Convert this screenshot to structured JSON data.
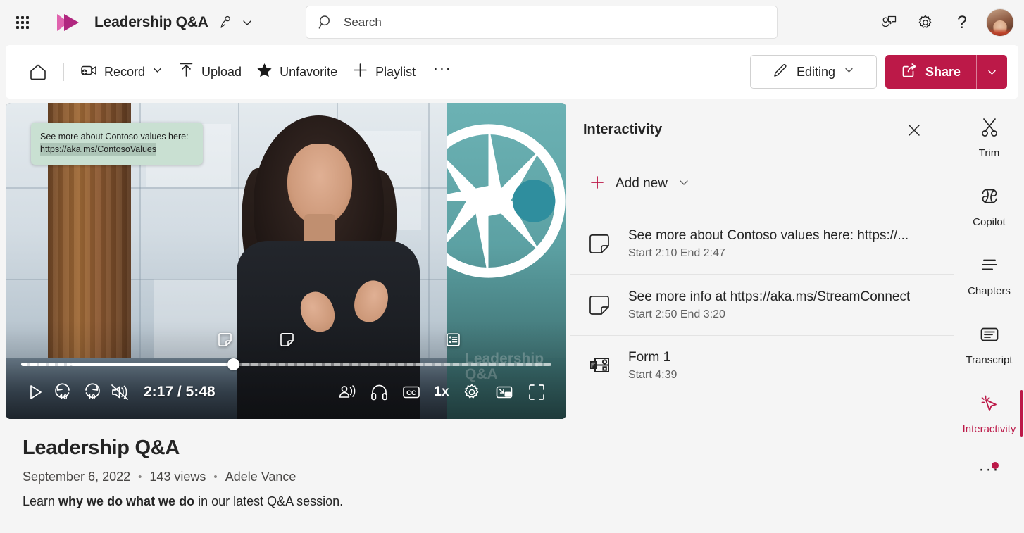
{
  "theme": {
    "accent": "#bc1948",
    "brand_pink": "#d94c9a",
    "brand_magenta": "#b0267f"
  },
  "header": {
    "waffle_icon": "app-launcher-icon",
    "logo_icon": "microsoft-stream-logo",
    "app_title": "Leadership Q&A",
    "title_people_icon": "people-shared-icon",
    "title_chevron_icon": "chevron-down-icon",
    "search": {
      "icon": "search-icon",
      "placeholder": "Search",
      "value": ""
    },
    "feedback_icon": "feedback-icon",
    "settings_icon": "gear-icon",
    "help_icon": "?",
    "help_label": "help-question-icon",
    "avatar_name": "avatar"
  },
  "commandbar": {
    "home_icon": "home-icon",
    "items": [
      {
        "label": "Record",
        "icon": "video-record-icon",
        "has_chevron": true
      },
      {
        "label": "Upload",
        "icon": "upload-arrow-icon",
        "has_chevron": false
      },
      {
        "label": "Unfavorite",
        "icon": "star-filled-icon",
        "has_chevron": false
      },
      {
        "label": "Playlist",
        "icon": "plus-icon",
        "has_chevron": false
      }
    ],
    "overflow_label": "···",
    "editing": {
      "label": "Editing",
      "icon": "pencil-icon",
      "chevron": "chevron-down-icon"
    },
    "share": {
      "label": "Share",
      "icon": "share-icon",
      "chevron": "chevron-down-icon"
    }
  },
  "player": {
    "callout": {
      "line1": "See more about Contoso values here:",
      "link": "https://aka.ms/ContosoValues"
    },
    "watermark": "Leadership\nQ&A",
    "timecode": "2:17 / 5:48",
    "current_time": "2:17",
    "duration": "5:48",
    "progress_percent": 40,
    "speed": "1x",
    "controls": {
      "play_icon": "play-icon",
      "rewind_label": "10",
      "rewind_icon": "rewind-10-icon",
      "forward_label": "10",
      "forward_icon": "forward-10-icon",
      "mute_icon": "volume-muted-icon",
      "noise_icon": "noise-suppression-icon",
      "audio_icon": "headphones-icon",
      "captions_icon": "closed-captions-icon",
      "settings_icon": "gear-icon",
      "pip_icon": "picture-in-picture-icon",
      "fullscreen_icon": "fullscreen-icon"
    },
    "timeline_markers": [
      {
        "icon": "sticky-note-icon",
        "position_percent": 37
      },
      {
        "icon": "sticky-note-icon",
        "position_percent": 49
      },
      {
        "icon": "form-list-icon",
        "position_percent": 79
      }
    ]
  },
  "video_meta": {
    "title": "Leadership Q&A",
    "date": "September 6, 2022",
    "views": "143 views",
    "author": "Adele Vance",
    "separator": "•",
    "description_pre": "Learn ",
    "description_bold": "why we do what we do",
    "description_post": " in our latest Q&A session."
  },
  "interactivity_panel": {
    "title": "Interactivity",
    "close_icon": "close-icon",
    "add_new": {
      "label": "Add new",
      "icon": "plus-icon",
      "chevron": "chevron-down-icon"
    },
    "items": [
      {
        "icon": "sticky-note-icon",
        "title": "See more about Contoso values here: https://...",
        "time": "Start 2:10 End 2:47"
      },
      {
        "icon": "sticky-note-icon",
        "title": "See more info at https://aka.ms/StreamConnect",
        "time": "Start 2:50 End 3:20"
      },
      {
        "icon": "form-icon",
        "title": "Form 1",
        "time": "Start 4:39"
      }
    ]
  },
  "rail": {
    "items": [
      {
        "label": "Trim",
        "icon": "scissors-icon",
        "active": false
      },
      {
        "label": "Copilot",
        "icon": "copilot-icon",
        "active": false
      },
      {
        "label": "Chapters",
        "icon": "chapters-lines-icon",
        "active": false
      },
      {
        "label": "Transcript",
        "icon": "transcript-icon",
        "active": false
      },
      {
        "label": "Interactivity",
        "icon": "interactivity-cursor-icon",
        "active": true
      }
    ],
    "overflow_label": "···",
    "overflow_badge": true
  }
}
